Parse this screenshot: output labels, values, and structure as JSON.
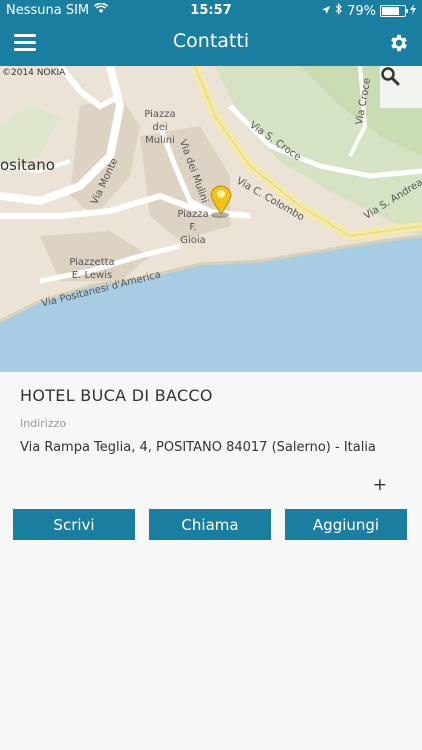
{
  "status_bar": {
    "carrier": "Nessuna SIM",
    "time": "15:57",
    "battery": "79%"
  },
  "header": {
    "title": "Contatti"
  },
  "map": {
    "credit": "©2014 NOKIA",
    "labels": {
      "positano": "ositano",
      "piazza_dei_mulini": "Piazza dei Mulini",
      "via_monte": "Via Monte",
      "via_dei_mulini": "Via dei Mulini",
      "via_s_croce": "Via S. Croce",
      "via_c_colombo": "Via C. Colombo",
      "via_s_andrea": "Via S. Andrea",
      "via_croce": "Via Croce",
      "piazza_f_gioia": "Piazza F. Gioia",
      "piazzetta_e_lewis": "Piazzetta E. Lewis",
      "via_positanesi": "Via Positanesi d'America"
    }
  },
  "contact": {
    "name": "HOTEL BUCA DI BACCO",
    "address_label": "Indirizzo",
    "address": "Via Rampa Teglia, 4, POSITANO 84017 (Salerno) - Italia",
    "plus": "+"
  },
  "actions": {
    "write": "Scrivi",
    "call": "Chiama",
    "add": "Aggiungi"
  },
  "colors": {
    "accent": "#1a7ea0"
  }
}
